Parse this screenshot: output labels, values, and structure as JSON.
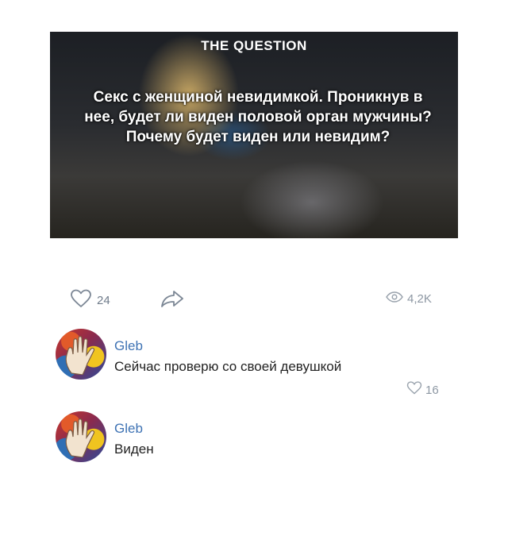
{
  "post": {
    "banner_title": "THE QUESTION",
    "banner_text": "Секс с женщиной невидимкой. Проникнув в нее, будет ли виден половой орган мужчины? Почему будет виден или невидим?"
  },
  "actions": {
    "like_count": "24",
    "views_count": "4,2K"
  },
  "comments": [
    {
      "author": "Gleb",
      "text": "Сейчас проверю со своей девушкой",
      "likes": "16"
    },
    {
      "author": "Gleb",
      "text": "Виден"
    }
  ],
  "icons": {
    "like": "heart-icon",
    "share": "share-arrow-icon",
    "views": "eye-icon",
    "comment_like": "heart-icon"
  },
  "colors": {
    "link": "#3f73b4",
    "muted": "#8d97a3"
  }
}
